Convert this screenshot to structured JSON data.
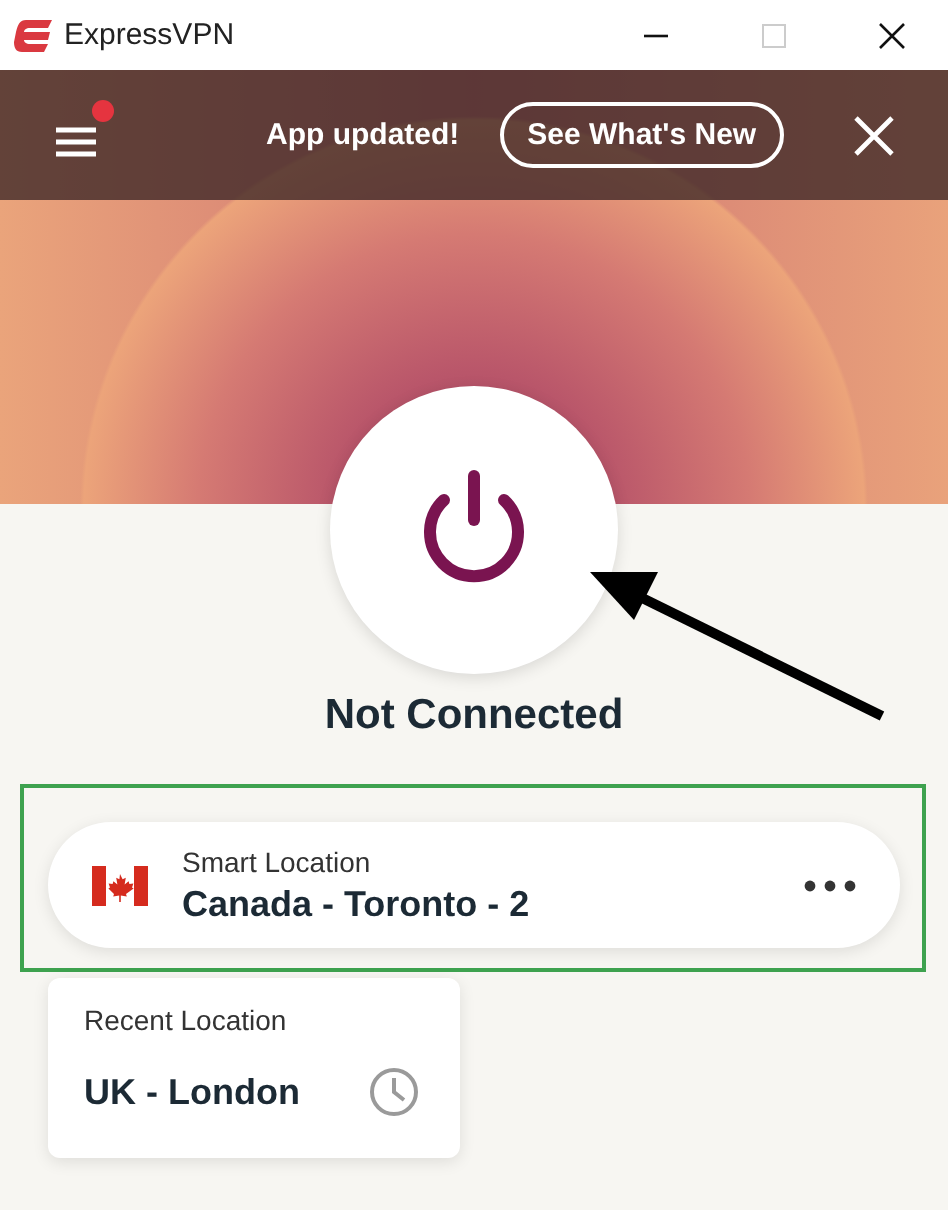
{
  "window": {
    "title": "ExpressVPN"
  },
  "banner": {
    "menu_badge": true,
    "message": "App updated!",
    "button": "See What's New"
  },
  "status": "Not Connected",
  "location": {
    "label": "Smart Location",
    "name": "Canada - Toronto - 2",
    "highlighted": true
  },
  "recent": {
    "label": "Recent Location",
    "name": "UK - London"
  }
}
